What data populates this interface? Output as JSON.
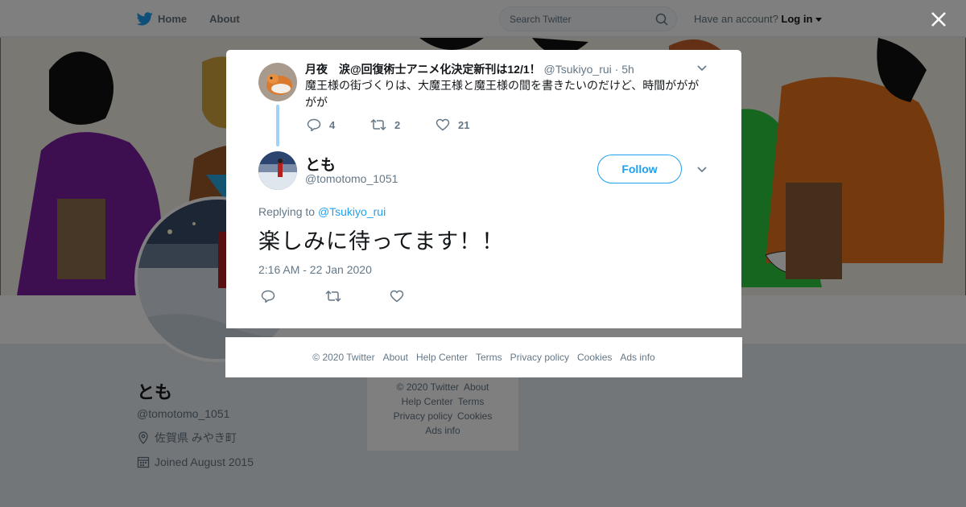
{
  "topbar": {
    "home_label": "Home",
    "about_label": "About",
    "search_placeholder": "Search Twitter",
    "account_prompt": "Have an account?",
    "login_label": "Log in"
  },
  "profile": {
    "name": "とも",
    "handle": "@tomotomo_1051",
    "location": "佐賀県 みやき町",
    "joined": "Joined August 2015"
  },
  "side_footer": {
    "copyright": "© 2020 Twitter",
    "about": "About",
    "help": "Help Center",
    "terms": "Terms",
    "privacy": "Privacy policy",
    "cookies": "Cookies",
    "ads": "Ads info"
  },
  "parent_tweet": {
    "name": "月夜　涙@回復術士アニメ化決定新刊は12/1！",
    "handle": "@Tsukiyo_rui",
    "time": "· 5h",
    "text": "魔王様の街づくりは、大魔王様と魔王様の間を書きたいのだけど、時間ががががが",
    "replies": "4",
    "retweets": "2",
    "likes": "21"
  },
  "main_tweet": {
    "name": "とも",
    "handle": "@tomotomo_1051",
    "follow_label": "Follow",
    "replying_prefix": "Replying to",
    "replying_to": "@Tsukiyo_rui",
    "text": "楽しみに待ってます！！",
    "timestamp": "2:16 AM - 22 Jan 2020"
  },
  "modal_footer": {
    "copyright": "© 2020 Twitter",
    "about": "About",
    "help": "Help Center",
    "terms": "Terms",
    "privacy": "Privacy policy",
    "cookies": "Cookies",
    "ads": "Ads info"
  },
  "colors": {
    "twitter_blue": "#1da1f2",
    "thread_line": "#a0d4f6",
    "secondary_text": "#657786"
  }
}
